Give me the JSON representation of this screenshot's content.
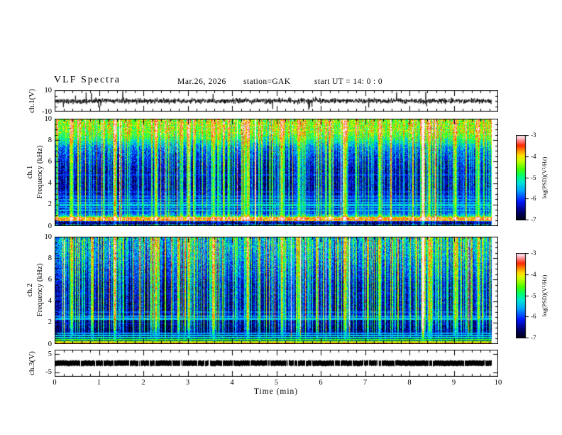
{
  "header": {
    "title": "VLF  Spectra",
    "date": "Mar.26, 2026",
    "station": "station=GAK",
    "start_ut": "start UT =  14: 0  : 0"
  },
  "time_axis": {
    "label": "Time  (min)",
    "ticks": [
      "0",
      "1",
      "2",
      "3",
      "4",
      "5",
      "6",
      "7",
      "8",
      "9",
      "10"
    ],
    "range": [
      0,
      10
    ],
    "minor_step": 0.2,
    "data_end_min": 9.85
  },
  "colorbar": {
    "label": "log(PSD)(V²/Hz)",
    "ticks": [
      "-3",
      "-4",
      "-5",
      "-6",
      "-7"
    ],
    "range": [
      -7,
      -3
    ]
  },
  "colors": {
    "background": "#ffffff",
    "frame": "#000000",
    "trace": "#000000",
    "colormap_stops": [
      [
        0.0,
        "#000014"
      ],
      [
        0.1,
        "#00006e"
      ],
      [
        0.22,
        "#0018ff"
      ],
      [
        0.35,
        "#00a8ff"
      ],
      [
        0.45,
        "#00e8d0"
      ],
      [
        0.52,
        "#00ff70"
      ],
      [
        0.6,
        "#45ff00"
      ],
      [
        0.7,
        "#c8ff00"
      ],
      [
        0.76,
        "#ffe400"
      ],
      [
        0.82,
        "#ff9000"
      ],
      [
        0.88,
        "#ff2800"
      ],
      [
        0.93,
        "#ff7878"
      ],
      [
        0.97,
        "#ffc8d2"
      ],
      [
        1.0,
        "#fff0f4"
      ]
    ]
  },
  "chart_data": [
    {
      "id": "ch1_waveform",
      "type": "line",
      "channel": "ch.1",
      "ylabel": "ch.1(V)",
      "yticks": [
        {
          "v": 10,
          "label": "10"
        },
        {
          "v": -10,
          "label": "-10"
        }
      ],
      "yrange": [
        -10,
        10
      ],
      "y_minor_ticks": [
        -5,
        0,
        5
      ],
      "description": "noisy voltage trace centered on 0 V with impulsive spikes",
      "signal": {
        "mean_v": 0,
        "noise_sd_v": 1.2,
        "spike_prob": 0.03,
        "spike_min_v": 2.5,
        "spike_max_v": 9,
        "seed": 11
      }
    },
    {
      "id": "ch1_spectrogram",
      "type": "heatmap",
      "channel": "ch.1",
      "ylabel_lines": [
        "ch.1",
        "Frequency  (kHz)"
      ],
      "yticks": [
        {
          "v": 0,
          "label": "0"
        },
        {
          "v": 2,
          "label": "2"
        },
        {
          "v": 4,
          "label": "4"
        },
        {
          "v": 6,
          "label": "6"
        },
        {
          "v": 8,
          "label": "8"
        },
        {
          "v": 10,
          "label": "10"
        }
      ],
      "yrange": [
        0,
        10
      ],
      "y_minor_step": 0.5,
      "value_range": [
        -7,
        -3
      ],
      "units": "log(PSD)(V²/Hz)",
      "seed": 23,
      "base_profile": [
        [
          0,
          -5.0
        ],
        [
          0.1,
          -5.4
        ],
        [
          0.18,
          -6.7
        ],
        [
          0.42,
          -6.6
        ],
        [
          0.5,
          -3.95
        ],
        [
          0.65,
          -3.75
        ],
        [
          0.8,
          -3.95
        ],
        [
          0.92,
          -5.4
        ],
        [
          1.15,
          -5.95
        ],
        [
          1.4,
          -6.2
        ],
        [
          2.6,
          -6.35
        ],
        [
          3.2,
          -6.55
        ],
        [
          5.2,
          -6.5
        ],
        [
          6.3,
          -6.25
        ],
        [
          7.3,
          -5.85
        ],
        [
          8.1,
          -5.1
        ],
        [
          8.7,
          -4.65
        ],
        [
          10,
          -4.5
        ]
      ],
      "streak_gain": [
        [
          0,
          0.4
        ],
        [
          0.5,
          0.5
        ],
        [
          1.0,
          1.1
        ],
        [
          3,
          1.6
        ],
        [
          6,
          1.55
        ],
        [
          8,
          1.15
        ],
        [
          10,
          0.95
        ]
      ],
      "jitter": [
        [
          0,
          1.5
        ],
        [
          0.15,
          0.9
        ],
        [
          0.3,
          0.45
        ],
        [
          8,
          0.55
        ],
        [
          10,
          0.7
        ]
      ],
      "hlines": [
        [
          1.45,
          -5.5
        ],
        [
          1.7,
          -5.65
        ],
        [
          1.95,
          -5.35
        ],
        [
          2.2,
          -5.55
        ],
        [
          2.45,
          -5.7
        ],
        [
          2.75,
          -5.95
        ],
        [
          3.15,
          -6.1
        ],
        [
          4.75,
          -6.1
        ],
        [
          6.3,
          -6.2
        ]
      ],
      "events": [
        [
          0.38,
          1.6
        ],
        [
          1.35,
          2.1
        ],
        [
          2.28,
          1.8
        ],
        [
          3.02,
          1.7
        ],
        [
          3.58,
          1.5
        ],
        [
          4.35,
          1.9
        ],
        [
          5.12,
          1.6
        ],
        [
          5.5,
          1.5
        ],
        [
          6.55,
          1.8
        ],
        [
          7.32,
          1.6
        ],
        [
          8.3,
          3.2
        ],
        [
          8.44,
          1.8
        ],
        [
          9.03,
          1.7
        ],
        [
          9.55,
          1.5
        ]
      ]
    },
    {
      "id": "ch2_spectrogram",
      "type": "heatmap",
      "channel": "ch.2",
      "ylabel_lines": [
        "ch.2",
        "Frequency  (kHz)"
      ],
      "yticks": [
        {
          "v": 0,
          "label": "0"
        },
        {
          "v": 2,
          "label": "2"
        },
        {
          "v": 4,
          "label": "4"
        },
        {
          "v": 6,
          "label": "6"
        },
        {
          "v": 8,
          "label": "8"
        },
        {
          "v": 10,
          "label": "10"
        }
      ],
      "yrange": [
        0,
        10
      ],
      "y_minor_step": 0.5,
      "value_range": [
        -7,
        -3
      ],
      "units": "log(PSD)(V²/Hz)",
      "seed": 77,
      "base_profile": [
        [
          0,
          -6.6
        ],
        [
          1.1,
          -6.7
        ],
        [
          1.3,
          -6.8
        ],
        [
          2.1,
          -6.7
        ],
        [
          2.45,
          -6.35
        ],
        [
          3.1,
          -6.55
        ],
        [
          5.5,
          -6.45
        ],
        [
          6.5,
          -6.2
        ],
        [
          7.5,
          -6.0
        ],
        [
          8.5,
          -5.75
        ],
        [
          10,
          -5.6
        ]
      ],
      "streak_gain": [
        [
          0,
          0.35
        ],
        [
          0.8,
          0.8
        ],
        [
          1.5,
          1.45
        ],
        [
          3,
          1.7
        ],
        [
          6,
          1.6
        ],
        [
          8.5,
          1.5
        ],
        [
          10,
          1.4
        ]
      ],
      "jitter": [
        [
          0,
          0.5
        ],
        [
          1,
          0.5
        ],
        [
          8,
          0.55
        ],
        [
          10,
          0.7
        ]
      ],
      "hlines": [
        [
          0.05,
          -3.7,
          0.06
        ],
        [
          0.22,
          -4.25,
          0.06
        ],
        [
          0.4,
          -4.7,
          0.06
        ],
        [
          0.58,
          -5.1,
          0.05
        ],
        [
          0.78,
          -5.35,
          0.05
        ],
        [
          1.0,
          -5.6,
          0.04
        ],
        [
          1.9,
          -6.3,
          0.05
        ],
        [
          2.35,
          -5.5,
          0.07
        ],
        [
          2.6,
          -5.7,
          0.07
        ],
        [
          3.0,
          -5.9,
          0.06
        ],
        [
          4.75,
          -6.15,
          0.05
        ],
        [
          6.3,
          -6.25,
          0.05
        ]
      ],
      "events": [
        [
          0.38,
          1.6
        ],
        [
          1.35,
          2.1
        ],
        [
          2.28,
          1.8
        ],
        [
          3.02,
          1.7
        ],
        [
          3.58,
          1.5
        ],
        [
          4.35,
          1.9
        ],
        [
          5.12,
          1.6
        ],
        [
          5.5,
          1.5
        ],
        [
          6.55,
          1.8
        ],
        [
          7.32,
          1.6
        ],
        [
          8.3,
          3.2
        ],
        [
          8.44,
          1.8
        ],
        [
          9.03,
          1.7
        ],
        [
          9.55,
          1.5
        ]
      ]
    },
    {
      "id": "ch3_waveform",
      "type": "line",
      "channel": "ch.3",
      "ylabel": "ch.3(V)",
      "yticks": [
        {
          "v": 5,
          "label": "5"
        },
        {
          "v": -5,
          "label": "-5"
        }
      ],
      "yrange": [
        -7.5,
        7.5
      ],
      "y_minor_ticks": [],
      "description": "flat trace at 0 V",
      "signal": {
        "flat_value_v": 0,
        "thickness_v": 1.0,
        "seed": 5
      }
    }
  ]
}
